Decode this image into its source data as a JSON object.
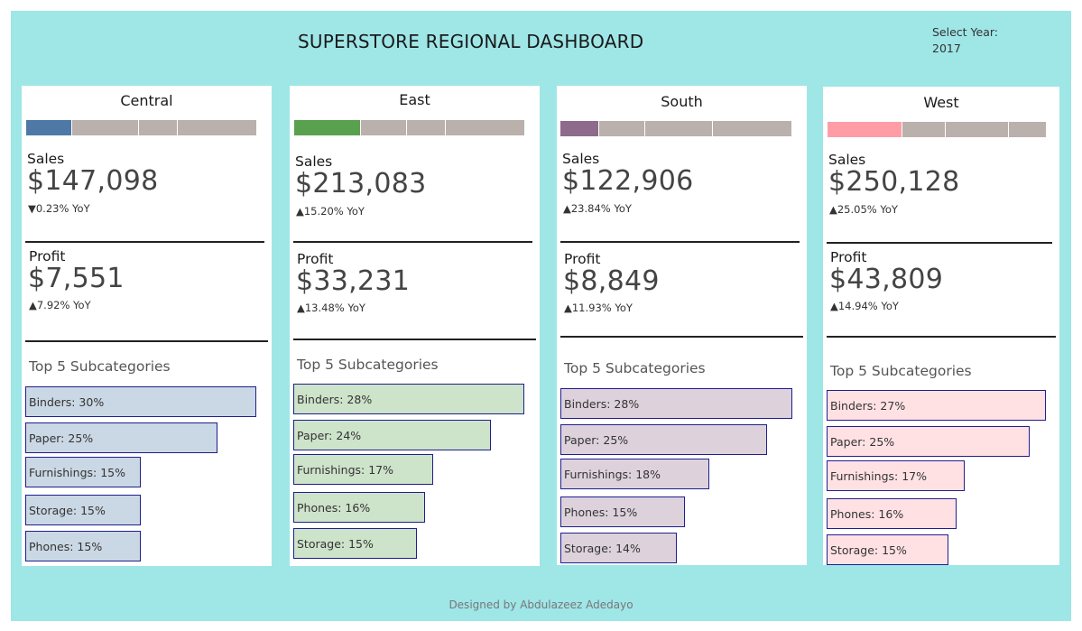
{
  "header": {
    "title": "SUPERSTORE REGIONAL DASHBOARD",
    "year_label": "Select Year:",
    "year_value": "2017"
  },
  "footer": {
    "credit": "Designed by Abdulazeez Adedayo"
  },
  "colors": {
    "background": "#9fe6e7",
    "neutral_segment": "#bab0ac",
    "Central": "#4e79a7",
    "East": "#59a14f",
    "South": "#8e6a8c",
    "West": "#ff9da7"
  },
  "regions": [
    {
      "name": "Central",
      "sales_label": "Sales",
      "sales": "$147,098",
      "sales_yoy": "▼0.23% YoY",
      "profit_label": "Profit",
      "profit": "$7,551",
      "profit_yoy": "▲7.92% YoY",
      "subcat_title": "Top 5 Subcategories",
      "subcats": [
        {
          "label": "Binders: 30%",
          "value": 30
        },
        {
          "label": "Paper: 25%",
          "value": 25
        },
        {
          "label": "Furnishings: 15%",
          "value": 15
        },
        {
          "label": "Storage: 15%",
          "value": 15
        },
        {
          "label": "Phones: 15%",
          "value": 15
        }
      ]
    },
    {
      "name": "East",
      "sales_label": "Sales",
      "sales": "$213,083",
      "sales_yoy": "▲15.20% YoY",
      "profit_label": "Profit",
      "profit": "$33,231",
      "profit_yoy": "▲13.48% YoY",
      "subcat_title": "Top 5 Subcategories",
      "subcats": [
        {
          "label": "Binders: 28%",
          "value": 28
        },
        {
          "label": "Paper: 24%",
          "value": 24
        },
        {
          "label": "Furnishings: 17%",
          "value": 17
        },
        {
          "label": "Phones: 16%",
          "value": 16
        },
        {
          "label": "Storage: 15%",
          "value": 15
        }
      ]
    },
    {
      "name": "South",
      "sales_label": "Sales",
      "sales": "$122,906",
      "sales_yoy": "▲23.84% YoY",
      "profit_label": "Profit",
      "profit": "$8,849",
      "profit_yoy": "▲11.93% YoY",
      "subcat_title": "Top 5 Subcategories",
      "subcats": [
        {
          "label": "Binders: 28%",
          "value": 28
        },
        {
          "label": "Paper: 25%",
          "value": 25
        },
        {
          "label": "Furnishings: 18%",
          "value": 18
        },
        {
          "label": "Phones: 15%",
          "value": 15
        },
        {
          "label": "Storage: 14%",
          "value": 14
        }
      ]
    },
    {
      "name": "West",
      "sales_label": "Sales",
      "sales": "$250,128",
      "sales_yoy": "▲25.05% YoY",
      "profit_label": "Profit",
      "profit": "$43,809",
      "profit_yoy": "▲14.94% YoY",
      "subcat_title": "Top 5 Subcategories",
      "subcats": [
        {
          "label": "Binders: 27%",
          "value": 27
        },
        {
          "label": "Paper: 25%",
          "value": 25
        },
        {
          "label": "Furnishings: 17%",
          "value": 17
        },
        {
          "label": "Phones: 16%",
          "value": 16
        },
        {
          "label": "Storage: 15%",
          "value": 15
        }
      ]
    }
  ],
  "chart_data": {
    "type": "bar",
    "title": "Top 5 Subcategories",
    "regional_sales_share": [
      {
        "region": "Central",
        "sales": 147098
      },
      {
        "region": "East",
        "sales": 213083
      },
      {
        "region": "South",
        "sales": 122906
      },
      {
        "region": "West",
        "sales": 250128
      }
    ],
    "series": [
      {
        "name": "Central",
        "categories": [
          "Binders",
          "Paper",
          "Furnishings",
          "Storage",
          "Phones"
        ],
        "values": [
          30,
          25,
          15,
          15,
          15
        ]
      },
      {
        "name": "East",
        "categories": [
          "Binders",
          "Paper",
          "Furnishings",
          "Phones",
          "Storage"
        ],
        "values": [
          28,
          24,
          17,
          16,
          15
        ]
      },
      {
        "name": "South",
        "categories": [
          "Binders",
          "Paper",
          "Furnishings",
          "Phones",
          "Storage"
        ],
        "values": [
          28,
          25,
          18,
          15,
          14
        ]
      },
      {
        "name": "West",
        "categories": [
          "Binders",
          "Paper",
          "Furnishings",
          "Phones",
          "Storage"
        ],
        "values": [
          27,
          25,
          17,
          16,
          15
        ]
      }
    ]
  }
}
